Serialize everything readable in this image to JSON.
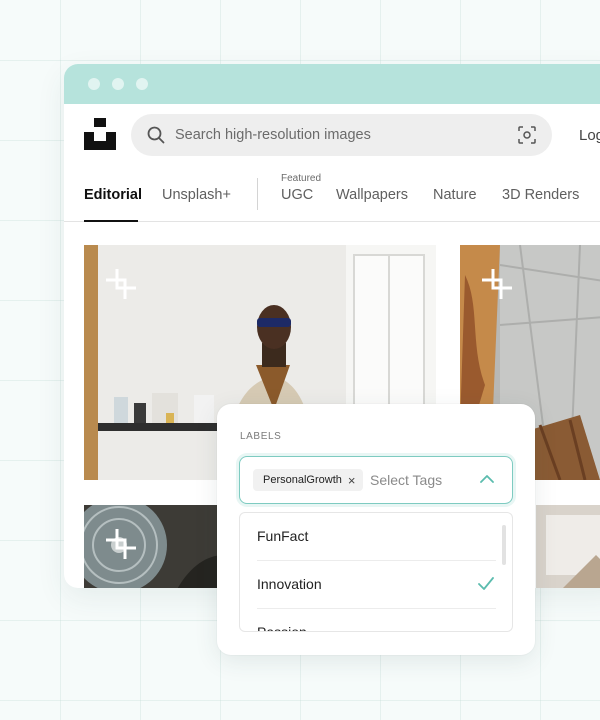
{
  "search": {
    "placeholder": "Search high-resolution images"
  },
  "header": {
    "login_label": "Log"
  },
  "nav": {
    "tabs": [
      "Editorial",
      "Unsplash+",
      "UGC",
      "Wallpapers",
      "Nature",
      "3D Renders"
    ],
    "featured_label": "Featured"
  },
  "popup": {
    "section_label": "LABELS",
    "selected_chip": "PersonalGrowth",
    "chip_remove": "×",
    "placeholder": "Select Tags",
    "options": [
      "FunFact",
      "Innovation",
      "Passion"
    ],
    "checked_option": "Innovation"
  },
  "colors": {
    "accent": "#6cc3b6",
    "titlebar": "#b6e3dc"
  },
  "icons": [
    "unsplash-logo",
    "search-icon",
    "visual-search-icon",
    "plus-mark-icon",
    "chevron-up-icon",
    "check-icon",
    "close-icon"
  ]
}
